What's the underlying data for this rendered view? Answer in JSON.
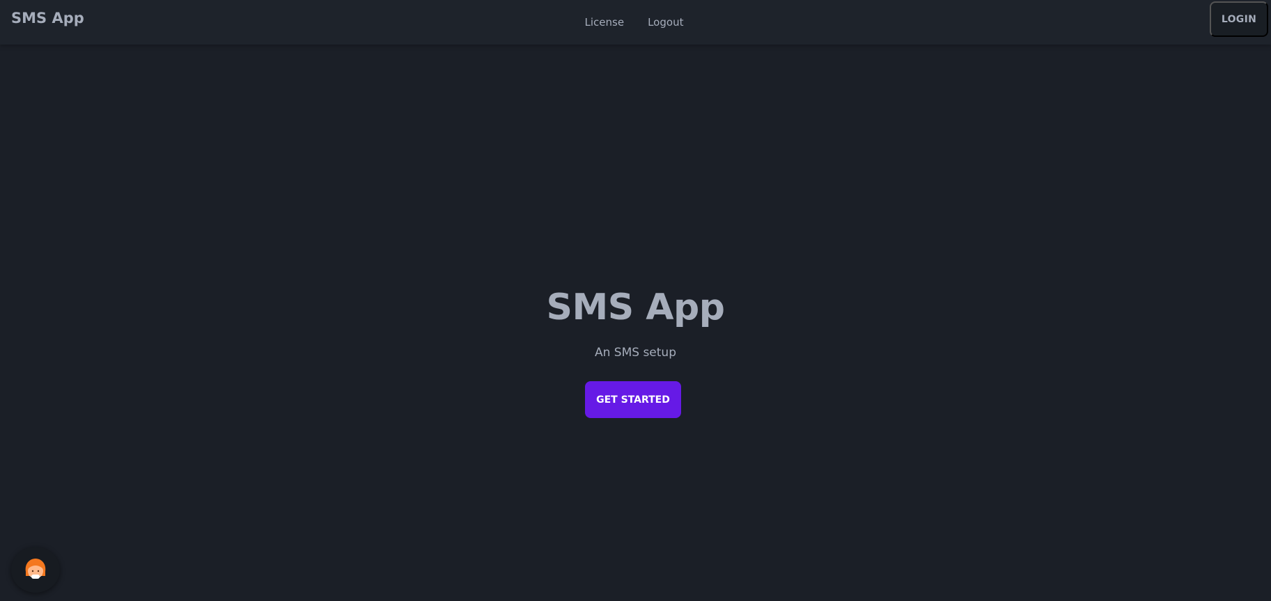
{
  "navbar": {
    "brand": "SMS App",
    "links": [
      {
        "label": "License"
      },
      {
        "label": "Logout"
      }
    ],
    "login_label": "LOGIN"
  },
  "hero": {
    "title": "SMS App",
    "subtitle": "An SMS setup",
    "cta_label": "GET STARTED"
  },
  "floating_badge": {
    "icon": "avatar-emoji-icon"
  },
  "colors": {
    "background": "#1b1f27",
    "navbar": "#1e232b",
    "text": "#a6adbb",
    "accent": "#661ae6"
  }
}
